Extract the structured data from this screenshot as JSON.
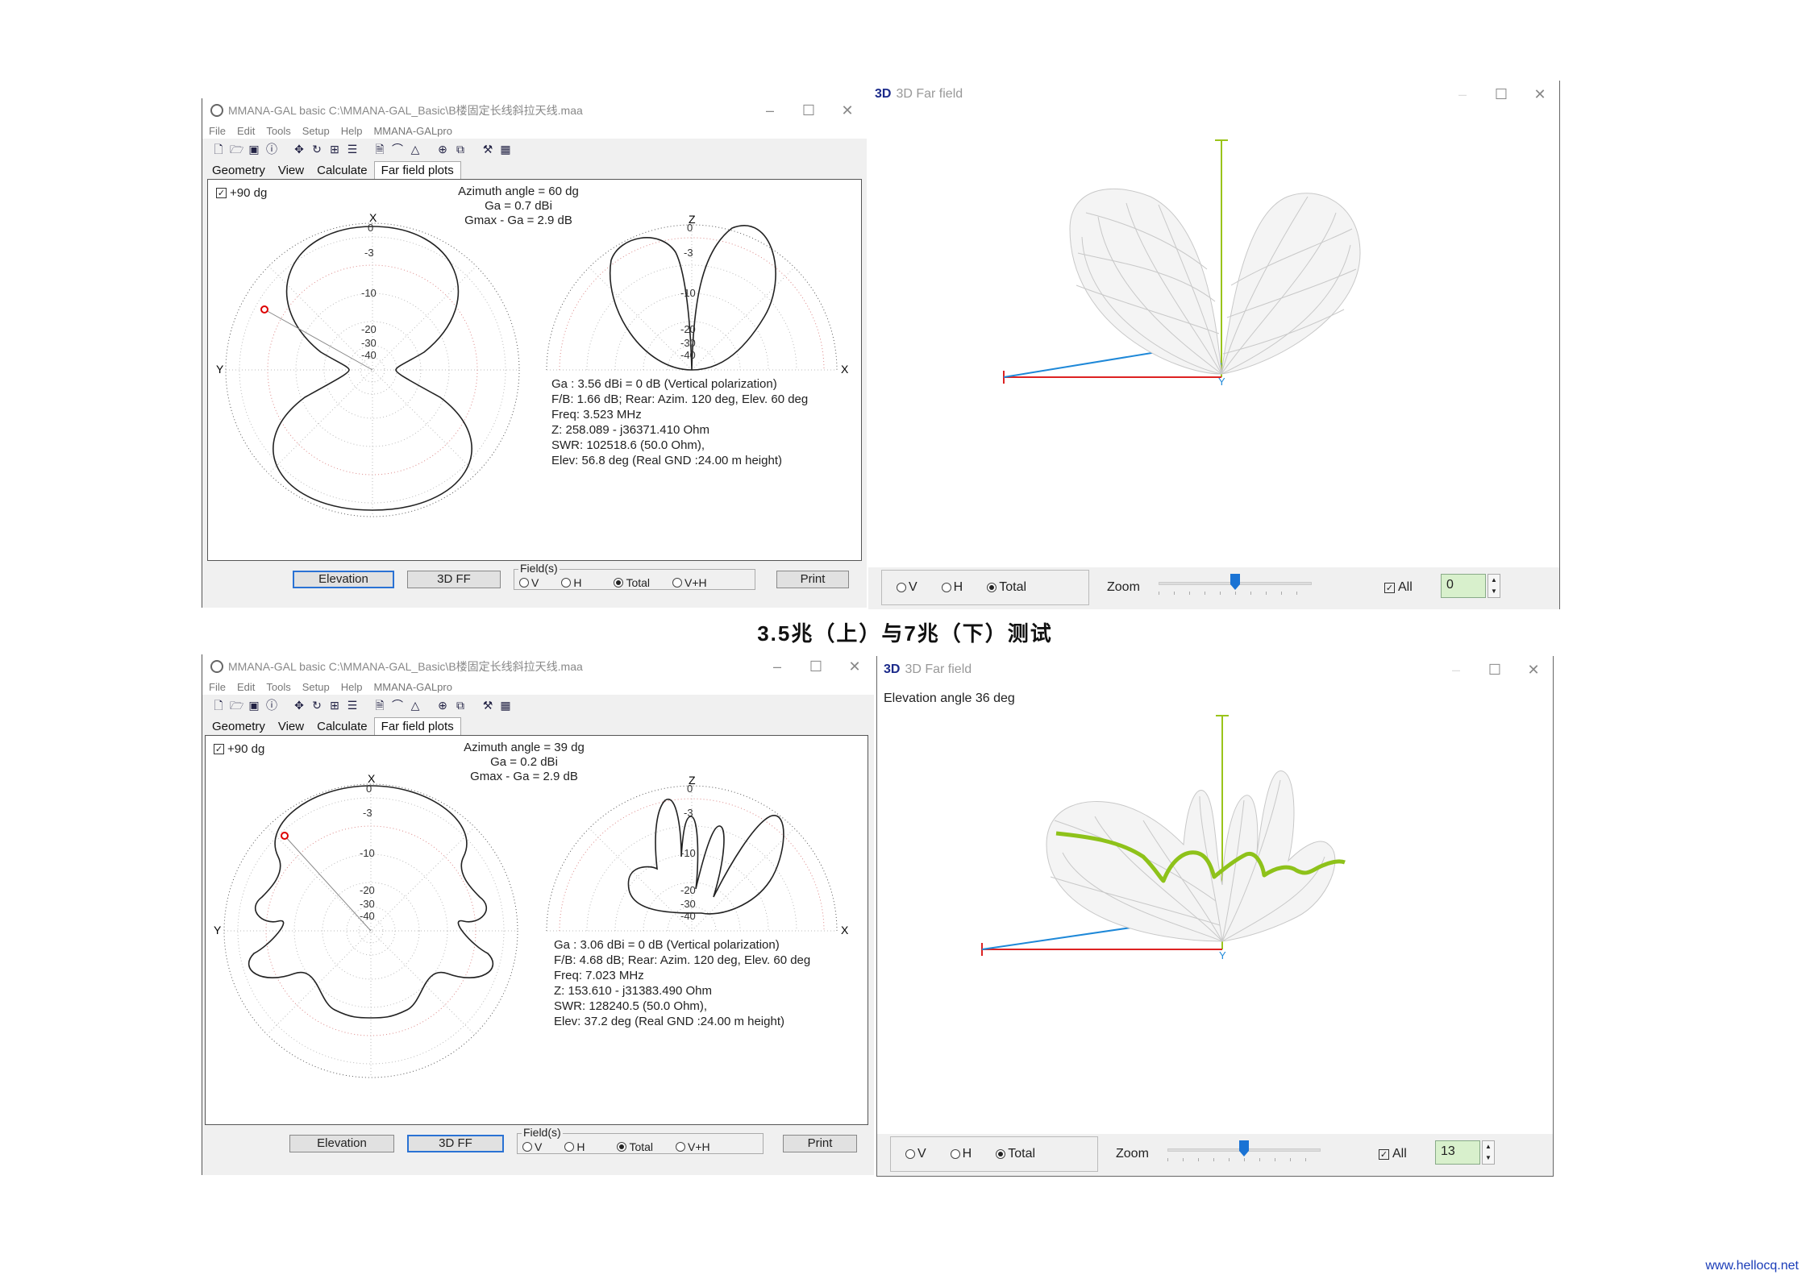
{
  "caption": "3.5兆（上）与7兆（下）测试",
  "watermark": "www.hellocq.net",
  "panels": [
    {
      "mmana": {
        "title": "MMANA-GAL basic C:\\MMANA-GAL_Basic\\B楼固定长线斜拉天线.maa",
        "menu": [
          "File",
          "Edit",
          "Tools",
          "Setup",
          "Help",
          "MMANA-GALpro"
        ],
        "tabs": [
          "Geometry",
          "View",
          "Calculate",
          "Far field plots"
        ],
        "active_tab": "Far field plots",
        "checkbox_label": "+90 dg",
        "azimuth": "Azimuth angle = 60 dg",
        "ga": "Ga = 0.7 dBi",
        "gmax": "Gmax - Ga = 2.9 dB",
        "horiz_labels": {
          "top": "X",
          "left": "Y",
          "rings": [
            "0",
            "-3",
            "-10",
            "-20",
            "-30",
            "-40"
          ]
        },
        "vert_labels": {
          "top": "Z",
          "right": "X",
          "rings": [
            "0",
            "-3",
            "-10",
            "-20",
            "-30",
            "-40"
          ]
        },
        "results": [
          "Ga : 3.56 dBi = 0 dB  (Vertical polarization)",
          "F/B: 1.66 dB; Rear: Azim. 120 deg,  Elev. 60 deg",
          "Freq: 3.523 MHz",
          "Z: 258.089 - j36371.410 Ohm",
          "SWR: 102518.6 (50.0 Ohm),",
          "Elev: 56.8 deg (Real GND  :24.00 m height)"
        ],
        "buttons": {
          "elevation": "Elevation",
          "ff3d": "3D FF",
          "print": "Print"
        },
        "selected_button": "elevation",
        "fields_legend": "Field(s)",
        "field_options": [
          "V",
          "H",
          "Total",
          "V+H"
        ],
        "field_selected": "Total"
      },
      "farfield": {
        "logo": "3D",
        "title": "3D Far field",
        "elevation_text": "",
        "options": [
          "V",
          "H",
          "Total"
        ],
        "selected": "Total",
        "zoom_label": "Zoom",
        "zoom_level": 0.5,
        "all_label": "All",
        "value": "0"
      }
    },
    {
      "mmana": {
        "title": "MMANA-GAL basic C:\\MMANA-GAL_Basic\\B楼固定长线斜拉天线.maa",
        "menu": [
          "File",
          "Edit",
          "Tools",
          "Setup",
          "Help",
          "MMANA-GALpro"
        ],
        "tabs": [
          "Geometry",
          "View",
          "Calculate",
          "Far field plots"
        ],
        "active_tab": "Far field plots",
        "checkbox_label": "+90 dg",
        "azimuth": "Azimuth angle = 39 dg",
        "ga": "Ga = 0.2 dBi",
        "gmax": "Gmax - Ga = 2.9 dB",
        "horiz_labels": {
          "top": "X",
          "left": "Y",
          "rings": [
            "0",
            "-3",
            "-10",
            "-20",
            "-30",
            "-40"
          ]
        },
        "vert_labels": {
          "top": "Z",
          "right": "X",
          "rings": [
            "0",
            "-3",
            "-10",
            "-20",
            "-30",
            "-40"
          ]
        },
        "results": [
          "Ga : 3.06 dBi = 0 dB  (Vertical polarization)",
          "F/B: 4.68 dB; Rear: Azim. 120 deg,  Elev. 60 deg",
          "Freq: 7.023 MHz",
          "Z: 153.610 - j31383.490 Ohm",
          "SWR: 128240.5 (50.0 Ohm),",
          "Elev: 37.2 deg (Real GND  :24.00 m height)"
        ],
        "buttons": {
          "elevation": "Elevation",
          "ff3d": "3D FF",
          "print": "Print"
        },
        "selected_button": "ff3d",
        "fields_legend": "Field(s)",
        "field_options": [
          "V",
          "H",
          "Total",
          "V+H"
        ],
        "field_selected": "Total"
      },
      "farfield": {
        "logo": "3D",
        "title": "3D Far field",
        "elevation_text": "Elevation angle 36 deg",
        "options": [
          "V",
          "H",
          "Total"
        ],
        "selected": "Total",
        "zoom_label": "Zoom",
        "zoom_level": 0.5,
        "all_label": "All",
        "value": "13"
      }
    }
  ]
}
